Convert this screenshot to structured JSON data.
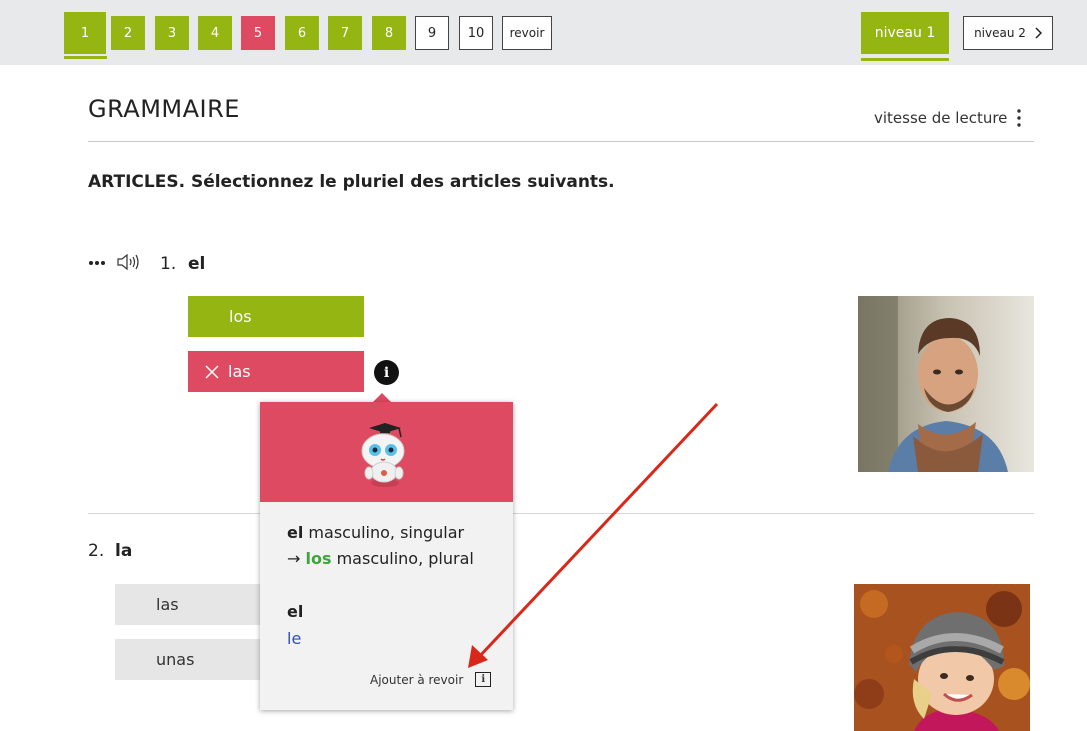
{
  "nav": {
    "questions": [
      {
        "label": "1",
        "state": "green"
      },
      {
        "label": "2",
        "state": "green"
      },
      {
        "label": "3",
        "state": "green"
      },
      {
        "label": "4",
        "state": "green"
      },
      {
        "label": "5",
        "state": "red"
      },
      {
        "label": "6",
        "state": "green"
      },
      {
        "label": "7",
        "state": "green"
      },
      {
        "label": "8",
        "state": "green"
      },
      {
        "label": "9",
        "state": "white"
      },
      {
        "label": "10",
        "state": "white"
      }
    ],
    "review_label": "revoir",
    "level1_label": "niveau 1",
    "level2_label": "niveau 2"
  },
  "header": {
    "title": "GRAMMAIRE",
    "speed_label": "vitesse de lecture"
  },
  "instructions": "ARTICLES. Sélectionnez le pluriel des articles suivants.",
  "question1": {
    "number": "1.",
    "word": "el",
    "option_correct": "los",
    "option_wrong": "las"
  },
  "question2": {
    "number": "2.",
    "word": "la",
    "option_a": "las",
    "option_b": "unas"
  },
  "popover": {
    "line1_bold": "el",
    "line1_rest": " masculino, singular",
    "line2_arrow": "→ ",
    "line2_green": "los",
    "line2_rest": " masculino, plural",
    "word": "el",
    "translation": "le",
    "add_review": "Ajouter à revoir"
  },
  "colors": {
    "green": "#95b512",
    "red": "#dd4a61",
    "annotation_arrow": "#d9281a"
  }
}
